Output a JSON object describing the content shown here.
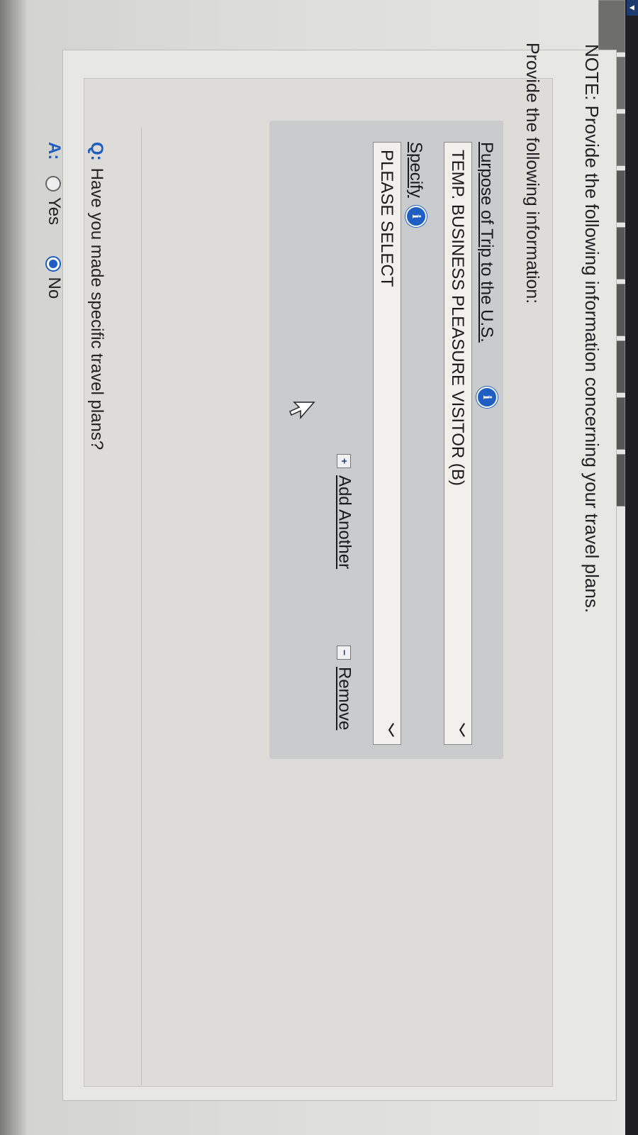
{
  "note": {
    "text": "NOTE: Provide the following information concerning your travel plans."
  },
  "section": {
    "intro": "Provide the following information:"
  },
  "form": {
    "purpose_label": "Purpose of Trip to the U.S.",
    "purpose_value": "TEMP. BUSINESS PLEASURE VISITOR (B)",
    "specify_label": "Specify",
    "specify_value": "PLEASE SELECT",
    "add_another": "Add Another",
    "remove": "Remove"
  },
  "question": {
    "prefix": "Q:",
    "text": "Have you made specific travel plans?",
    "answer_prefix": "A:",
    "options": [
      "Yes",
      "No"
    ],
    "selected": "No"
  },
  "icons": {
    "info": "info-icon",
    "chevron": "chevron-down-icon",
    "plus": "plus-icon",
    "minus": "minus-icon"
  },
  "colors": {
    "info_blue": "#1f5fc4",
    "form_box": "#c9cbcc"
  }
}
